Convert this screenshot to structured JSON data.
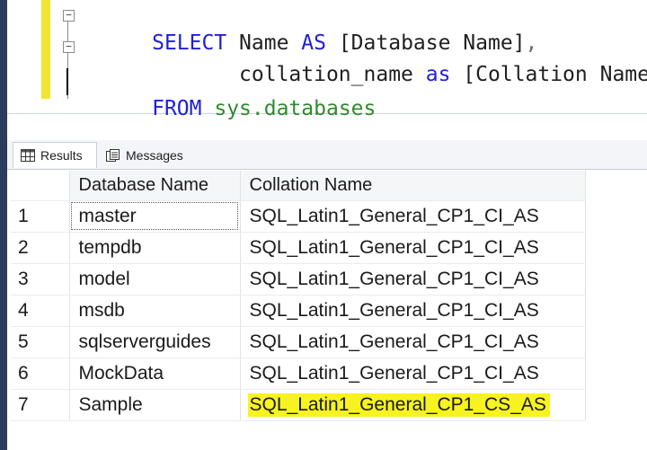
{
  "editor": {
    "lines": [
      {
        "fold": "minus",
        "parts": [
          {
            "cls": "kw",
            "text": "SELECT "
          },
          {
            "cls": "id",
            "text": "Name "
          },
          {
            "cls": "kw",
            "text": "AS "
          },
          {
            "cls": "id",
            "text": "[Database Name]"
          },
          {
            "cls": "punct",
            "text": ","
          }
        ]
      },
      {
        "fold": "minus",
        "parts": [
          {
            "cls": "id",
            "text": "       collation_name "
          },
          {
            "cls": "kw",
            "text": "as "
          },
          {
            "cls": "id",
            "text": "[Collation Name]"
          }
        ]
      },
      {
        "fold": "none",
        "parts": [
          {
            "cls": "kw",
            "text": "FROM "
          },
          {
            "cls": "sys",
            "text": "sys.databases"
          }
        ]
      }
    ]
  },
  "tabs": {
    "results_label": "Results",
    "messages_label": "Messages",
    "results_icon": "grid-icon",
    "messages_icon": "messages-icon"
  },
  "grid": {
    "columns": [
      "Database Name",
      "Collation Name"
    ],
    "rows": [
      {
        "num": "1",
        "name": "master",
        "collation": "SQL_Latin1_General_CP1_CI_AS",
        "highlight": false
      },
      {
        "num": "2",
        "name": "tempdb",
        "collation": "SQL_Latin1_General_CP1_CI_AS",
        "highlight": false
      },
      {
        "num": "3",
        "name": "model",
        "collation": "SQL_Latin1_General_CP1_CI_AS",
        "highlight": false
      },
      {
        "num": "4",
        "name": "msdb",
        "collation": "SQL_Latin1_General_CP1_CI_AS",
        "highlight": false
      },
      {
        "num": "5",
        "name": "sqlserverguides",
        "collation": "SQL_Latin1_General_CP1_CI_AS",
        "highlight": false
      },
      {
        "num": "6",
        "name": "MockData",
        "collation": "SQL_Latin1_General_CP1_CI_AS",
        "highlight": false
      },
      {
        "num": "7",
        "name": "Sample",
        "collation": "SQL_Latin1_General_CP1_CS_AS",
        "highlight": true
      }
    ],
    "highlight_color": "#f7f320"
  },
  "colors": {
    "keyword": "#1f1fd6",
    "system_object": "#2e8b2e",
    "change_bar": "#f2e531"
  }
}
